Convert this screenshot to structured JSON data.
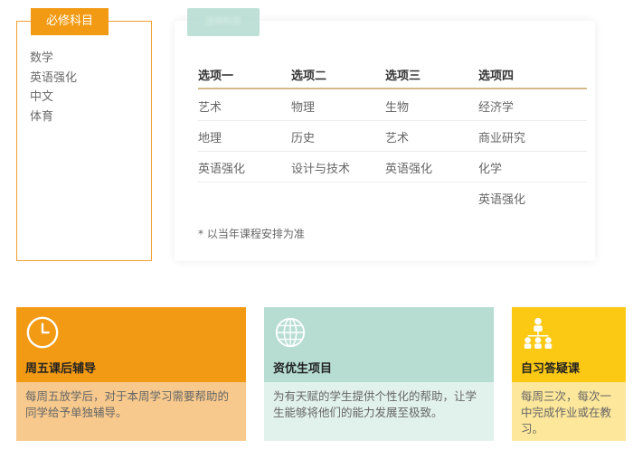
{
  "required": {
    "tab_label": "必修科目",
    "subjects": [
      "数学",
      "英语强化",
      "中文",
      "体育"
    ]
  },
  "electives": {
    "tab_label": "选修科目",
    "columns": [
      "选项一",
      "选项二",
      "选项三",
      "选项四"
    ],
    "rows": [
      [
        "艺术",
        "物理",
        "生物",
        "经济学"
      ],
      [
        "地理",
        "历史",
        "艺术",
        "商业研究"
      ],
      [
        "英语强化",
        "设计与技术",
        "英语强化",
        "化学"
      ],
      [
        "",
        "",
        "",
        "英语强化"
      ]
    ],
    "note": "* 以当年课程安排为准"
  },
  "features": [
    {
      "title": "周五课后辅导",
      "desc": "每周五放学后，对于本周学习需要帮助的同学给予单独辅导。",
      "icon": "clock-icon",
      "color": "#f29a13"
    },
    {
      "title": "资优生项目",
      "desc": "为有天赋的学生提供个性化的帮助，让学生能够将他们的能力发展至极致。",
      "icon": "globe-icon",
      "color": "#b7ddd3"
    },
    {
      "title": "自习答疑课",
      "desc_lines": [
        "每周三次，每次一",
        "中完成作业或在教",
        "习。"
      ],
      "icon": "people-network-icon",
      "color": "#fbc913"
    }
  ]
}
